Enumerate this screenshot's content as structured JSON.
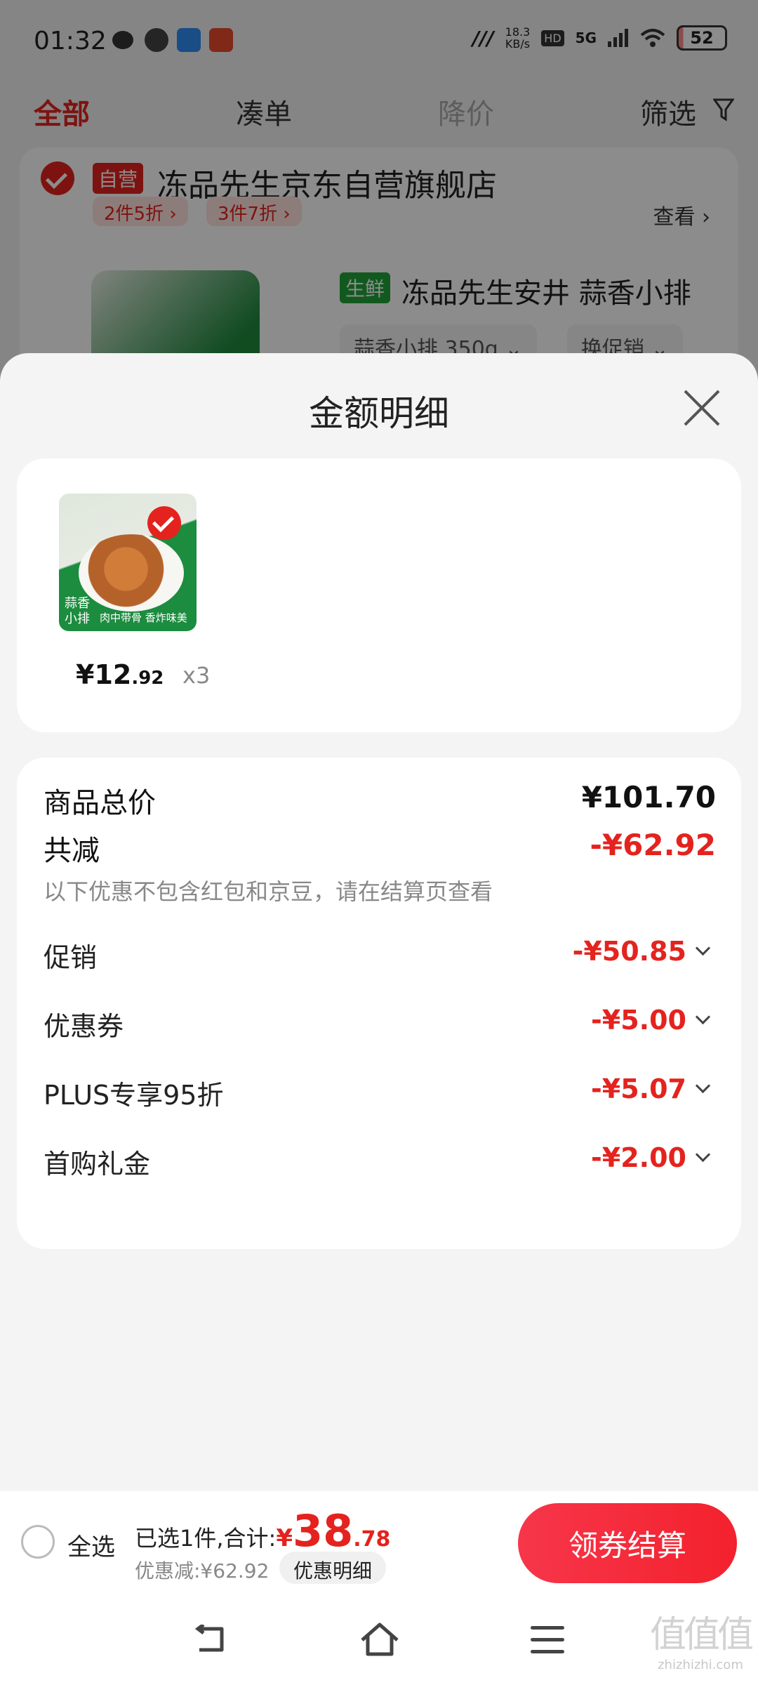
{
  "status_bar": {
    "time": "01:32",
    "network_speed": "18.3\nKB/s",
    "network_type": "5G",
    "battery": "52",
    "app_icons": [
      "wechat-icon",
      "zhi-icon",
      "messages-icon",
      "app-icon"
    ]
  },
  "tabs": [
    {
      "label": "全部",
      "active": true
    },
    {
      "label": "凑单",
      "active": false
    },
    {
      "label": "降价",
      "active": false
    },
    {
      "label": "筛选",
      "active": false
    }
  ],
  "shop": {
    "self_operated_tag": "自营",
    "name": "冻品先生京东自营旗舰店",
    "promos": [
      "2件5折 ›",
      "3件7折 ›"
    ],
    "view_label": "查看",
    "product_tag": "生鲜",
    "product_title": "冻品先生安井 蒜香小排",
    "sku": "蒜香小排 350g ⌄",
    "change_promo": "换促销 ⌄"
  },
  "sheet": {
    "title": "金额明细",
    "item": {
      "thumb_label": "蒜香\n小排",
      "thumb_caption": "肉中带骨 香炸味美",
      "price_symbol": "¥",
      "price_int": "12",
      "price_dec": ".92",
      "qty": "x3"
    },
    "breakdown": {
      "total_label": "商品总价",
      "total_value": "¥101.70",
      "reduced_label": "共减",
      "reduced_value": "-¥62.92",
      "note": "以下优惠不包含红包和京豆，请在结算页查看",
      "discounts": [
        {
          "label": "促销",
          "value": "-¥50.85"
        },
        {
          "label": "优惠券",
          "value": "-¥5.00"
        },
        {
          "label": "PLUS专享95折",
          "value": "-¥5.07"
        },
        {
          "label": "首购礼金",
          "value": "-¥2.00"
        }
      ]
    }
  },
  "action_bar": {
    "select_all": "全选",
    "selected_text": "已选1件,合计:",
    "currency": "¥",
    "total_int": "38",
    "total_dec": ".78",
    "discount_text": "优惠减:¥62.92",
    "detail_label": "优惠明细",
    "checkout_label": "领券结算"
  },
  "watermark": {
    "glyph": "值值值",
    "site": "zhizhizhi.com"
  },
  "colors": {
    "accent": "#e4231e",
    "green_tag": "#22a33a"
  }
}
